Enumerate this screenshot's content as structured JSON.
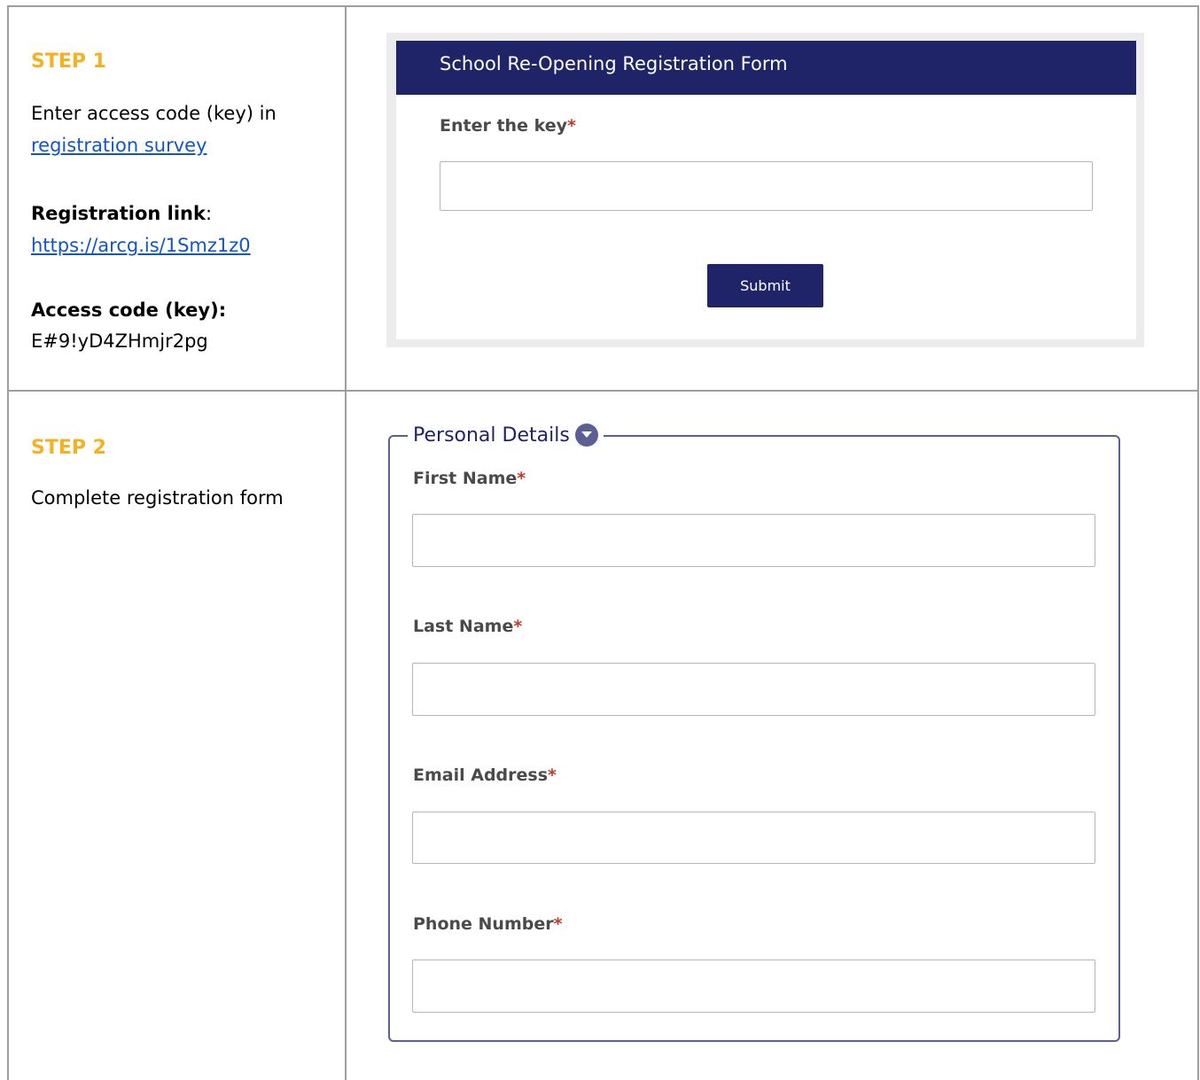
{
  "step1": {
    "title": "STEP 1",
    "instruction_prefix": "Enter access code (key) in",
    "instruction_link": "registration survey",
    "registration_label": "Registration link",
    "registration_colon": ":",
    "registration_url": "https://arcg.is/1Smz1z0",
    "access_label": "Access code (key):",
    "access_code": "E#9!yD4ZHmjr2pg",
    "form": {
      "header_title": "School Re-Opening Registration Form",
      "key_label": "Enter the key",
      "required_mark": "*",
      "key_value": "",
      "submit_label": "Submit"
    }
  },
  "step2": {
    "title": "STEP 2",
    "instruction": "Complete registration form",
    "form": {
      "section_title": "Personal Details",
      "required_mark": "*",
      "fields": [
        {
          "label": "First Name",
          "value": ""
        },
        {
          "label": "Last Name",
          "value": ""
        },
        {
          "label": "Email Address",
          "value": ""
        },
        {
          "label": "Phone Number",
          "value": ""
        }
      ]
    }
  },
  "colors": {
    "step_title": "#f4b121",
    "link": "#1155cc",
    "form_header": "#1f2469",
    "required": "#c0392b",
    "fieldset_border": "#5b5f93"
  },
  "icons": {
    "section_toggle": "chevron-down-icon"
  }
}
